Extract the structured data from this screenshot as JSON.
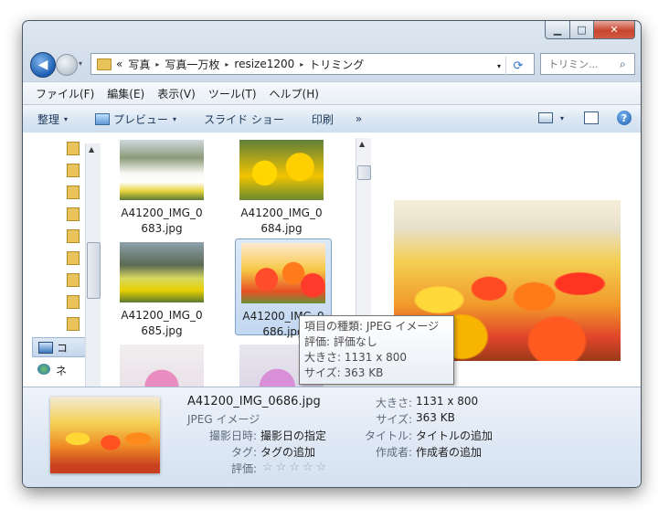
{
  "titlebar": {
    "min": "▁",
    "max": "□",
    "close": "✕"
  },
  "nav": {
    "back_glyph": "◀",
    "dropdown_glyph": "▾"
  },
  "address": {
    "prefix": "«",
    "crumbs": [
      "写真",
      "写真一万枚",
      "resize1200",
      "トリミング"
    ],
    "sep": "▸",
    "dropdown_glyph": "▾",
    "refresh_glyph": "⟳"
  },
  "search": {
    "placeholder": "トリミン...",
    "icon": "search-icon",
    "icon_glyph": "⌕"
  },
  "menu": [
    "ファイル(F)",
    "編集(E)",
    "表示(V)",
    "ツール(T)",
    "ヘルプ(H)"
  ],
  "toolbar": {
    "organize": "整理",
    "preview": "プレビュー",
    "slideshow": "スライド ショー",
    "print": "印刷",
    "more": "»",
    "caret": "▾",
    "help": "?"
  },
  "navpane": {
    "items_count_label": "",
    "computer_label": "コ",
    "network_label": "ネ"
  },
  "files": [
    {
      "line1": "A41200_IMG_0",
      "line2": "683.jpg"
    },
    {
      "line1": "A41200_IMG_0",
      "line2": "684.jpg"
    },
    {
      "line1": "A41200_IMG_0",
      "line2": "685.jpg"
    },
    {
      "line1": "A41200_IMG_0",
      "line2": "686.jpg"
    }
  ],
  "scroll": {
    "up": "▲",
    "down": "▼"
  },
  "tooltip": {
    "type": "項目の種類: JPEG イメージ",
    "rating": "評価: 評価なし",
    "dimensions": "大きさ: 1131 x 800",
    "size": "サイズ: 363 KB"
  },
  "details": {
    "name": "A41200_IMG_0686.jpg",
    "type": "JPEG イメージ",
    "left": [
      {
        "label": "撮影日時:",
        "value": "撮影日の指定"
      },
      {
        "label": "タグ:",
        "value": "タグの追加"
      },
      {
        "label": "評価:",
        "value": ""
      }
    ],
    "right": [
      {
        "label": "大きさ:",
        "value": "1131 x 800"
      },
      {
        "label": "サイズ:",
        "value": "363 KB"
      },
      {
        "label": "タイトル:",
        "value": "タイトルの追加"
      },
      {
        "label": "作成者:",
        "value": "作成者の追加"
      }
    ],
    "star_glyph": "☆",
    "rating_stars": 0
  }
}
